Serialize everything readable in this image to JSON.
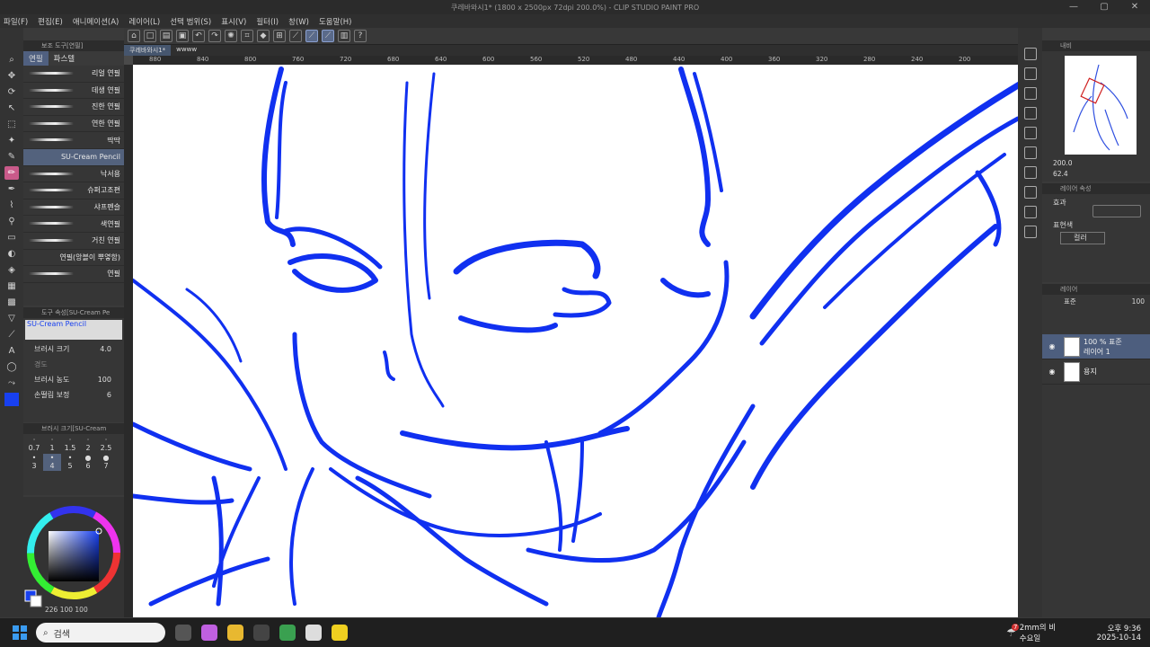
{
  "window": {
    "title": "쿠레바와시1* (1800 x 2500px 72dpi 200.0%) - CLIP STUDIO PAINT PRO",
    "controls": [
      "—",
      "▢",
      "✕"
    ]
  },
  "menu": [
    "파일(F)",
    "편집(E)",
    "애니메이션(A)",
    "레이어(L)",
    "선택 범위(S)",
    "표시(V)",
    "필터(I)",
    "창(W)",
    "도움말(H)"
  ],
  "subtool_panel": {
    "title": "보조 도구[연필]",
    "tabs": [
      "연필",
      "파스텔"
    ],
    "brushes": [
      "리얼 연필",
      "데생 연필",
      "진한 연필",
      "연한 연필",
      "딱딱",
      "SU-Cream Pencil",
      "낙서용",
      "슈퍼고조편",
      "샤프펜슬",
      "색연필",
      "거친 연필",
      "연필(앙블이 뿌옇함)",
      "연필"
    ],
    "selected_brush": "SU-Cream Pencil"
  },
  "tool_property": {
    "title": "도구 속성[SU-Cream Pe",
    "brush_name": "SU-Cream Pencil",
    "rows": [
      {
        "label": "브러시 크기",
        "value": "4.0"
      },
      {
        "label": "경도",
        "value": ""
      },
      {
        "label": "브러시 농도",
        "value": "100"
      },
      {
        "label": "손떨림 보정",
        "value": "6"
      }
    ]
  },
  "brush_size_panel": {
    "title": "브러시 크기[SU-Cream",
    "sizes": [
      "0.7",
      "1",
      "1.5",
      "2",
      "2.5",
      "3",
      "4",
      "5",
      "6",
      "7"
    ],
    "selected": "4"
  },
  "color": {
    "main": "#1840f0",
    "readout": "226 100 100"
  },
  "document": {
    "tabs": [
      "쿠레바와시1*",
      "wwww"
    ],
    "ruler_ticks": [
      "880",
      "840",
      "800",
      "760",
      "720",
      "680",
      "640",
      "600",
      "560",
      "520",
      "480",
      "440",
      "400",
      "360",
      "320",
      "280",
      "240",
      "200"
    ],
    "stroke_color": "#1030f0"
  },
  "navigator": {
    "title": "내비",
    "zoom": "200.0",
    "angle": "62.4"
  },
  "layer_property": {
    "title": "레이어 속성",
    "effect_label": "효과",
    "expression_label": "표현색",
    "expression_value": "컬러"
  },
  "layers": {
    "title": "레이어",
    "blend": "표준",
    "opacity": "100",
    "items": [
      {
        "name": "레이어 1",
        "info": "100 % 표준"
      },
      {
        "name": "용지",
        "info": ""
      }
    ]
  },
  "taskbar": {
    "search_placeholder": "검색",
    "weather_badge": "7",
    "weather_title": "2mm의 비",
    "weather_sub": "수요일",
    "time": "오후 9:36",
    "date": "2025-10-14"
  }
}
